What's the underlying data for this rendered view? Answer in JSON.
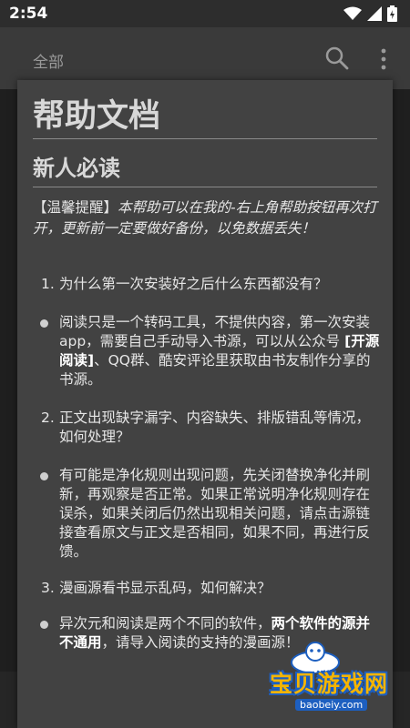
{
  "status_bar": {
    "time": "2:54"
  },
  "app_bar": {
    "title": "全部"
  },
  "help": {
    "title": "帮助文档",
    "section_title": "新人必读",
    "tip_label": "【温馨提醒】",
    "tip_text": "本帮助可以在我的-右上角帮助按钮再次打开，更新前一定要做好备份，以免数据丢失！",
    "q1_num": "1.",
    "q1": "为什么第一次安装好之后什么东西都没有？",
    "a1_pre": "阅读只是一个转码工具，不提供内容，第一次安装app，需要自己手动导入书源，可以从公众号 ",
    "a1_bold": "[开源阅读]",
    "a1_post": "、QQ群、酷安评论里获取由书友制作分享的书源。",
    "q2_num": "2.",
    "q2": "正文出现缺字漏字、内容缺失、排版错乱等情况，如何处理？",
    "a2": "有可能是净化规则出现问题，先关闭替换净化并刷新，再观察是否正常。如果正常说明净化规则存在误杀，如果关闭后仍然出现相关问题，请点击源链接查看原文与正文是否相同，如果不同，再进行反馈。",
    "q3_num": "3.",
    "q3": "漫画源看书显示乱码，如何解决？",
    "a3_pre": "异次元和阅读是两个不同的软件，",
    "a3_bold": "两个软件的源并不通用",
    "a3_post": "，请导入阅读的支持的漫画源！"
  },
  "watermark": {
    "text": "宝贝游戏网",
    "url": "baobeiy.com"
  },
  "colors": {
    "accent": "#e8583a",
    "dialog_bg": "#424242",
    "app_bar_bg": "#3a3a3a"
  },
  "icons": [
    "wifi-icon",
    "signal-icon",
    "battery-icon",
    "search-icon",
    "more-vert-icon",
    "bookshelf-icon",
    "explore-icon",
    "rss-icon",
    "mine-icon"
  ]
}
